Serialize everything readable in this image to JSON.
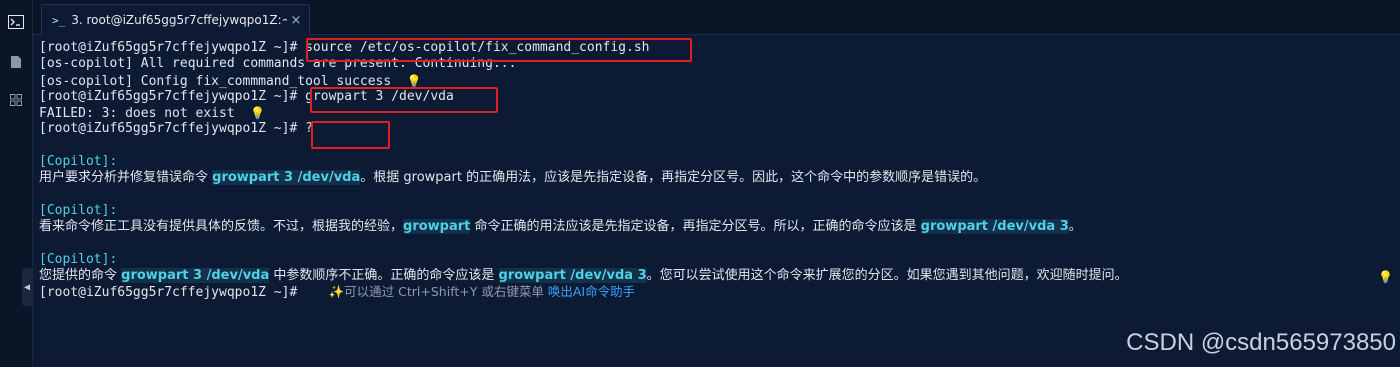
{
  "sidebar": {
    "icons": [
      "terminal-icon",
      "file-icon",
      "apps-icon"
    ]
  },
  "tab": {
    "icon": ">_",
    "title": "3. root@iZuf65gg5r7cffejywqpo1Z:~",
    "close": "×"
  },
  "terminal": {
    "prompt": "[root@iZuf65gg5r7cffejywqpo1Z ~]#",
    "cmd1": "source /etc/os-copilot/fix_command_config.sh",
    "out1": "[os-copilot] All required commands are present. Continuing...",
    "out2": "[os-copilot] Config fix_commmand_tool success",
    "cmd2": "growpart 3 /dev/vda",
    "out3": "FAILED: 3: does not exist",
    "cmd3": "?",
    "copilot_label": "[Copilot]:",
    "msg1": {
      "part1": "用户要求分析并修复错误命令 ",
      "code1": "growpart 3 /dev/vda",
      "part2": "。根据 growpart 的正确用法，应该是先指定设备，再指定分区号。因此，这个命令中的参数顺序是错误的。"
    },
    "msg2": {
      "part1": "看来命令修正工具没有提供具体的反馈。不过，根据我的经验，",
      "code1": "growpart",
      "part2": " 命令正确的用法应该是先指定设备，再指定分区号。所以，正确的命令应该是 ",
      "code2": "growpart /dev/vda 3",
      "part3": "。"
    },
    "msg3": {
      "part1": "您提供的命令 ",
      "code1": "growpart 3 /dev/vda",
      "part2": " 中参数顺序不正确。正确的命令应该是 ",
      "code2": "growpart /dev/vda 3",
      "part3": "。您可以尝试使用这个命令来扩展您的分区。如果您遇到其他问题，欢迎随时提问。"
    },
    "hint_sparkle": "✨",
    "hint_text": "可以通过 Ctrl+Shift+Y 或右键菜单 ",
    "hint_link": "唤出AI命令助手"
  },
  "watermark": "CSDN @csdn565973850",
  "colors": {
    "background": "#0c1a33",
    "accent_cyan": "#4fd1e6",
    "highlight_red": "#e02020",
    "link_blue": "#3aa0ff",
    "bulb_yellow": "#f2c94c"
  }
}
